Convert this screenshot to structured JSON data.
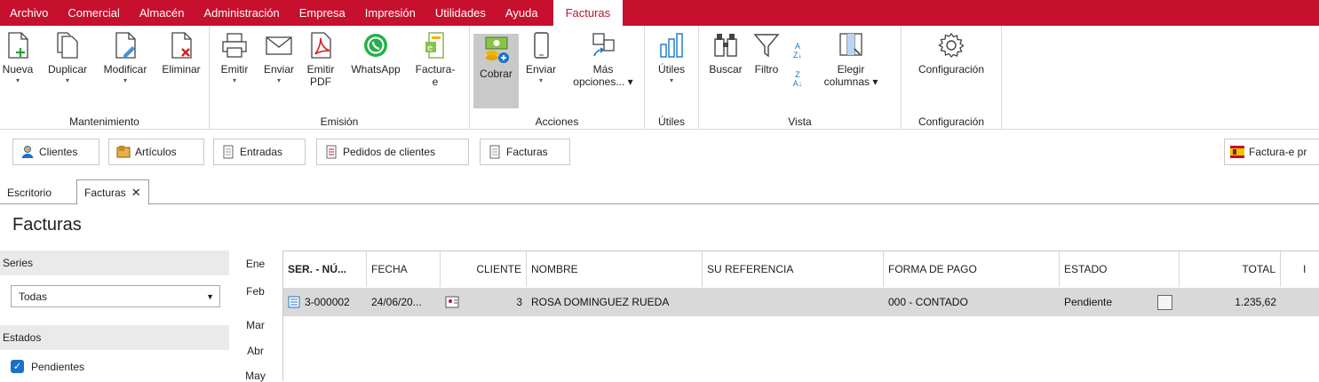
{
  "menu": {
    "items": [
      "Archivo",
      "Comercial",
      "Almacén",
      "Administración",
      "Empresa",
      "Impresión",
      "Utilidades",
      "Ayuda"
    ],
    "active": "Facturas"
  },
  "ribbon": {
    "groups": {
      "mantenimiento": "Mantenimiento",
      "emision": "Emisión",
      "acciones": "Acciones",
      "utiles": "Útiles",
      "vista": "Vista",
      "configuracion": "Configuración"
    },
    "buttons": {
      "nueva": "Nueva",
      "duplicar": "Duplicar",
      "modificar": "Modificar",
      "eliminar": "Eliminar",
      "emitir": "Emitir",
      "enviar_emision": "Enviar",
      "emitir_pdf_1": "Emitir",
      "emitir_pdf_2": "PDF",
      "whatsapp": "WhatsApp",
      "facturae_1": "Factura-",
      "facturae_2": "e",
      "cobrar": "Cobrar",
      "enviar_acciones": "Enviar",
      "mas_1": "Más",
      "mas_2": "opciones... ▾",
      "utiles": "Útiles",
      "buscar": "Buscar",
      "filtro": "Filtro",
      "elegir_1": "Elegir",
      "elegir_2": "columnas ▾",
      "configuracion": "Configuración"
    }
  },
  "quickbar": {
    "clientes": "Clientes",
    "articulos": "Artículos",
    "entradas": "Entradas",
    "pedidos": "Pedidos de clientes",
    "facturas": "Facturas",
    "facturae_pr": "Factura-e pr"
  },
  "tabs": {
    "escritorio": "Escritorio",
    "facturas": "Facturas"
  },
  "page_title": "Facturas",
  "filters": {
    "series_label": "Series",
    "series_value": "Todas",
    "estados_label": "Estados",
    "pendientes": "Pendientes"
  },
  "months": [
    "Ene",
    "Feb",
    "Mar",
    "Abr",
    "May"
  ],
  "table": {
    "columns": [
      "SER. - NÚ...",
      "FECHA",
      "CLIENTE",
      "NOMBRE",
      "SU REFERENCIA",
      "FORMA DE PAGO",
      "ESTADO",
      "TOTAL",
      "I"
    ],
    "rows": [
      {
        "ser": "3-000002",
        "fecha": "24/06/20...",
        "cliente": "3",
        "nombre": "ROSA DOMINGUEZ RUEDA",
        "su_referencia": "",
        "forma_pago": "000 - CONTADO",
        "estado": "Pendiente",
        "total": "1.235,62"
      }
    ]
  },
  "colors": {
    "menubar": "#c6102e",
    "accent_check": "#1a73c9",
    "row_selected": "#d9d9d9"
  }
}
